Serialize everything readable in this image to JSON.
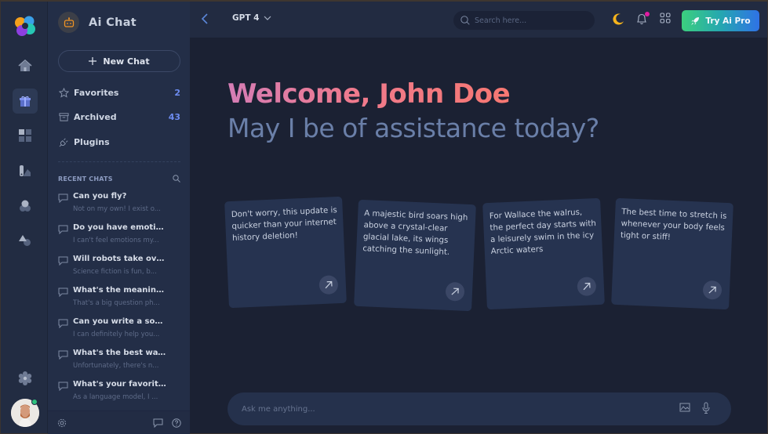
{
  "app": {
    "title": "Ai Chat"
  },
  "rail": {
    "items": [
      {
        "name": "home",
        "icon": "home-icon",
        "active": false
      },
      {
        "name": "gifts",
        "icon": "gift-icon",
        "active": true
      },
      {
        "name": "dashboard",
        "icon": "grid-icon",
        "active": false
      },
      {
        "name": "palette",
        "icon": "swatch-icon",
        "active": false
      },
      {
        "name": "shapes",
        "icon": "circles-icon",
        "active": false
      },
      {
        "name": "components",
        "icon": "shapes-icon",
        "active": false
      }
    ],
    "settings_icon": "gear-icon",
    "user_status": "online"
  },
  "panel": {
    "title": "Ai Chat",
    "new_chat_label": "New Chat",
    "nav": [
      {
        "label": "Favorites",
        "count": "2",
        "icon": "star-icon"
      },
      {
        "label": "Archived",
        "count": "43",
        "icon": "archive-icon"
      },
      {
        "label": "Plugins",
        "count": "",
        "icon": "plug-icon"
      }
    ],
    "recent_label": "RECENT CHATS",
    "recent": [
      {
        "title": "Can you fly?",
        "snippet": "Not on my own! I exist o..."
      },
      {
        "title": "Do you have emotion...",
        "snippet": "I can't feel emotions my..."
      },
      {
        "title": "Will robots take over t...",
        "snippet": "Science fiction is fun, b..."
      },
      {
        "title": "What's the meaning o...",
        "snippet": "That's a big question ph..."
      },
      {
        "title": "Can you write a song ...",
        "snippet": "I can definitely help you..."
      },
      {
        "title": "What's the best way t...",
        "snippet": "Unfortunately, there's n..."
      },
      {
        "title": "What's your favorite c...",
        "snippet": "As a language model, I ..."
      }
    ]
  },
  "topbar": {
    "model": "GPT 4",
    "search_placeholder": "Search here...",
    "pro_label": "Try Ai Pro",
    "colors": {
      "notification_dot": "#e31ba3",
      "moon": "#f5b31c"
    }
  },
  "main": {
    "welcome": "Welcome, John Doe",
    "subtitle": "May I be of assistance today?",
    "cards": [
      {
        "text": "Don't worry, this update is quicker than your internet history deletion!"
      },
      {
        "text": "A majestic bird soars high above a crystal-clear glacial lake, its wings catching the sunlight."
      },
      {
        "text": "For Wallace the walrus, the perfect day starts with a leisurely swim in the icy Arctic waters"
      },
      {
        "text": "The best time to stretch is whenever your body feels tight or stiff!"
      }
    ],
    "composer_placeholder": "Ask me anything..."
  }
}
